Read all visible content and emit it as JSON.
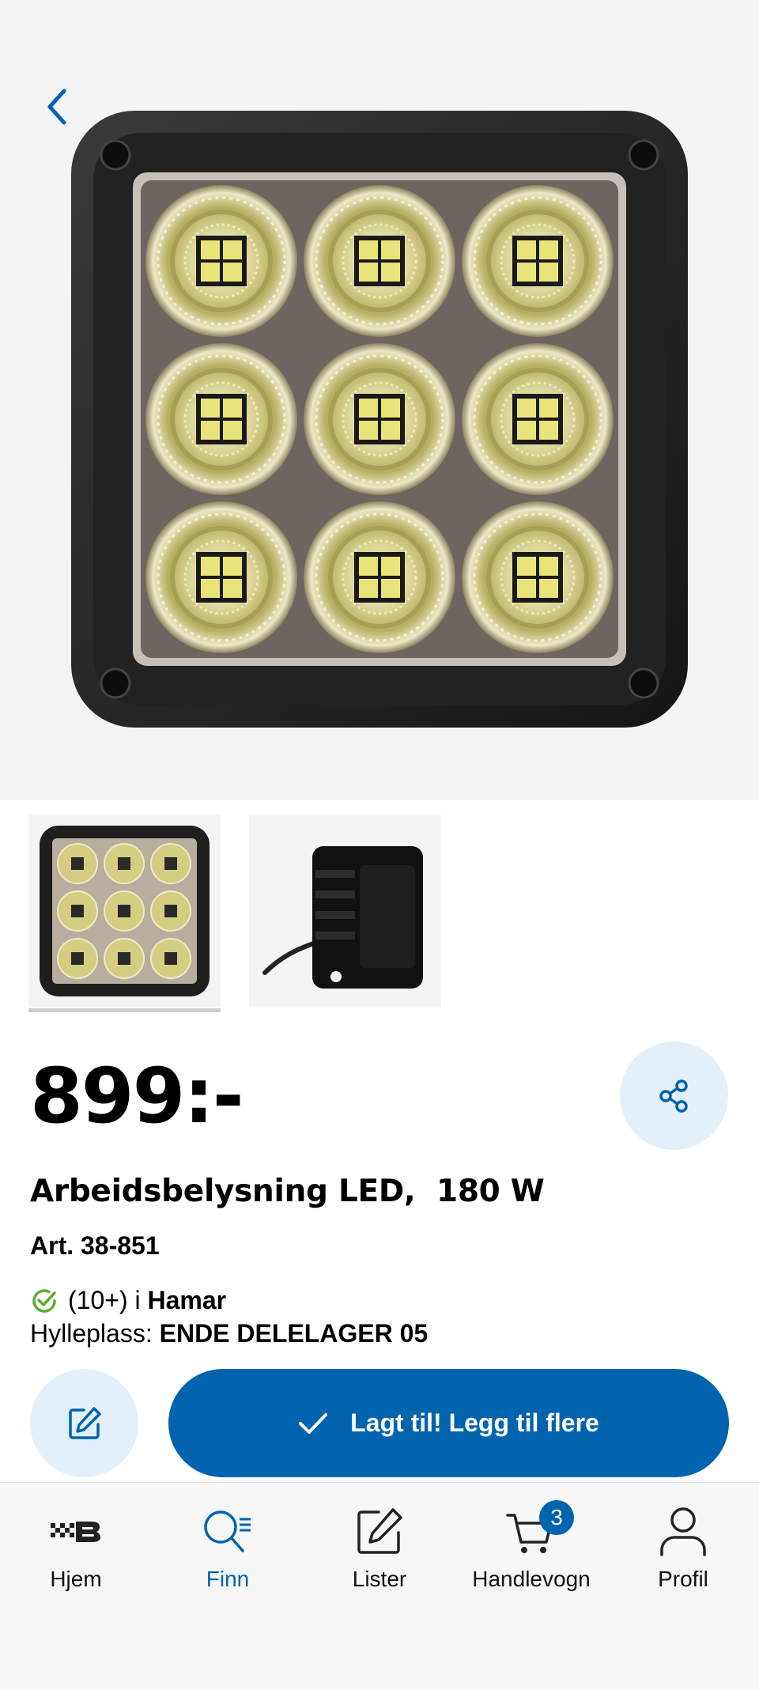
{
  "product": {
    "price": "899:-",
    "title": "Arbeidsbelysning LED,  180 W",
    "article": "Art. 38-851",
    "stock_count": "(10+) i",
    "stock_store": "Hamar",
    "shelf_label": "Hylleplass:",
    "shelf_value": "ENDE DELELAGER 05"
  },
  "actions": {
    "add_label": "Lagt til! Legg til flere"
  },
  "tabs": [
    {
      "label": "Hjem",
      "icon": "home-logo-icon"
    },
    {
      "label": "Finn",
      "icon": "search-icon"
    },
    {
      "label": "Lister",
      "icon": "edit-list-icon"
    },
    {
      "label": "Handlevogn",
      "icon": "cart-icon",
      "badge": "3"
    },
    {
      "label": "Profil",
      "icon": "profile-icon"
    }
  ],
  "colors": {
    "accent": "#0063ae",
    "light_accent": "#e3f0f9",
    "success": "#5ab031"
  }
}
